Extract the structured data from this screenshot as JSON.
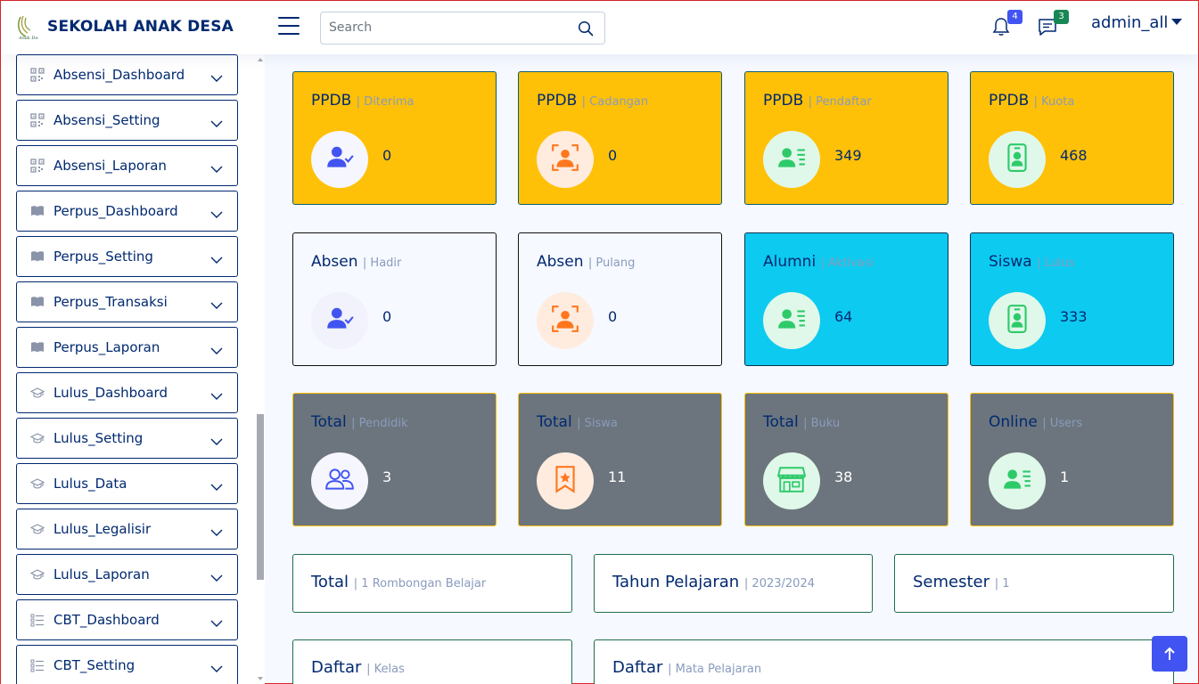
{
  "app": {
    "name": "SEKOLAH ANAK DESA"
  },
  "search": {
    "placeholder": "Search"
  },
  "header": {
    "notifications_count": "4",
    "messages_count": "3",
    "user_name": "admin_all"
  },
  "colors": {
    "primary": "#012970",
    "yellow": "#ffc107",
    "cyan": "#0dcaf0",
    "gray": "#6c757d",
    "accent_blue": "#4154f1",
    "badge_blue": "#4154f1",
    "badge_green": "#198754"
  },
  "sidebar": {
    "items": [
      {
        "label": "Absensi_Dashboard",
        "icon": "qr-code-icon"
      },
      {
        "label": "Absensi_Setting",
        "icon": "qr-code-icon"
      },
      {
        "label": "Absensi_Laporan",
        "icon": "qr-code-icon"
      },
      {
        "label": "Perpus_Dashboard",
        "icon": "book-icon"
      },
      {
        "label": "Perpus_Setting",
        "icon": "book-icon"
      },
      {
        "label": "Perpus_Transaksi",
        "icon": "book-icon"
      },
      {
        "label": "Perpus_Laporan",
        "icon": "book-icon"
      },
      {
        "label": "Lulus_Dashboard",
        "icon": "mortarboard-icon"
      },
      {
        "label": "Lulus_Setting",
        "icon": "mortarboard-icon"
      },
      {
        "label": "Lulus_Data",
        "icon": "mortarboard-icon"
      },
      {
        "label": "Lulus_Legalisir",
        "icon": "mortarboard-icon"
      },
      {
        "label": "Lulus_Laporan",
        "icon": "mortarboard-icon"
      },
      {
        "label": "CBT_Dashboard",
        "icon": "list-check-icon"
      },
      {
        "label": "CBT_Setting",
        "icon": "list-check-icon"
      }
    ]
  },
  "cards": [
    {
      "title": "PPDB",
      "sub": "| Diterima",
      "value": "0",
      "icon": "person-check-icon"
    },
    {
      "title": "PPDB",
      "sub": "| Cadangan",
      "value": "0",
      "icon": "person-bounding-box-icon"
    },
    {
      "title": "PPDB",
      "sub": "| Pendaftar",
      "value": "349",
      "icon": "person-lines-icon"
    },
    {
      "title": "PPDB",
      "sub": "| Kuota",
      "value": "468",
      "icon": "person-badge-icon"
    },
    {
      "title": "Absen",
      "sub": "| Hadir",
      "value": "0",
      "icon": "person-check-icon"
    },
    {
      "title": "Absen",
      "sub": "| Pulang",
      "value": "0",
      "icon": "person-bounding-box-icon"
    },
    {
      "title": "Alumni",
      "sub": "| Aktivasi",
      "value": "64",
      "icon": "person-lines-icon"
    },
    {
      "title": "Siswa",
      "sub": "| Lulus",
      "value": "333",
      "icon": "person-badge-icon"
    },
    {
      "title": "Total",
      "sub": "| Pendidik",
      "value": "3",
      "icon": "people-icon"
    },
    {
      "title": "Total",
      "sub": "| Siswa",
      "value": "11",
      "icon": "bookmark-star-icon"
    },
    {
      "title": "Total",
      "sub": "| Buku",
      "value": "38",
      "icon": "shop-icon"
    },
    {
      "title": "Online",
      "sub": "| Users",
      "value": "1",
      "icon": "person-lines-icon"
    }
  ],
  "info": [
    {
      "title": "Total",
      "sub": "| 1 Rombongan Belajar"
    },
    {
      "title": "Tahun Pelajaran",
      "sub": "| 2023/2024"
    },
    {
      "title": "Semester",
      "sub": "| 1"
    },
    {
      "title": "Daftar",
      "sub": "| Kelas"
    },
    {
      "title": "Daftar",
      "sub": "| Mata Pelajaran"
    }
  ]
}
